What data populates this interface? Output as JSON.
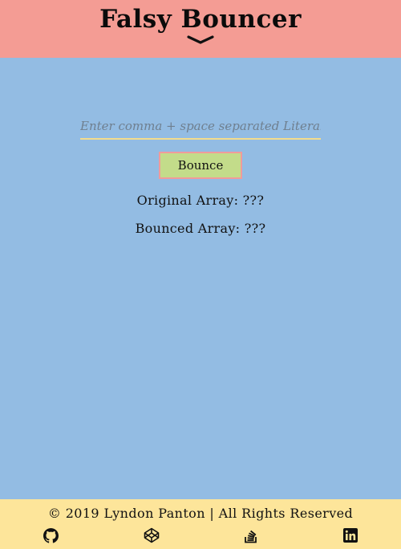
{
  "header": {
    "title": "Falsy Bouncer"
  },
  "form": {
    "placeholder": "Enter comma + space separated Literals",
    "value": "",
    "button_label": "Bounce"
  },
  "results": {
    "original": "Original Array: ???",
    "bounced": "Bounced Array: ???"
  },
  "footer": {
    "copyright": "© 2019 Lyndon Panton | All Rights Reserved",
    "icons": [
      "github-icon",
      "codepen-icon",
      "stackoverflow-icon",
      "linkedin-icon"
    ]
  },
  "colors": {
    "header_bg": "#f49c94",
    "main_bg": "#93bce3",
    "footer_bg": "#fde59a",
    "button_bg": "#c3dc8a",
    "button_border": "#f09b9b",
    "input_underline": "#f3dc8c"
  }
}
